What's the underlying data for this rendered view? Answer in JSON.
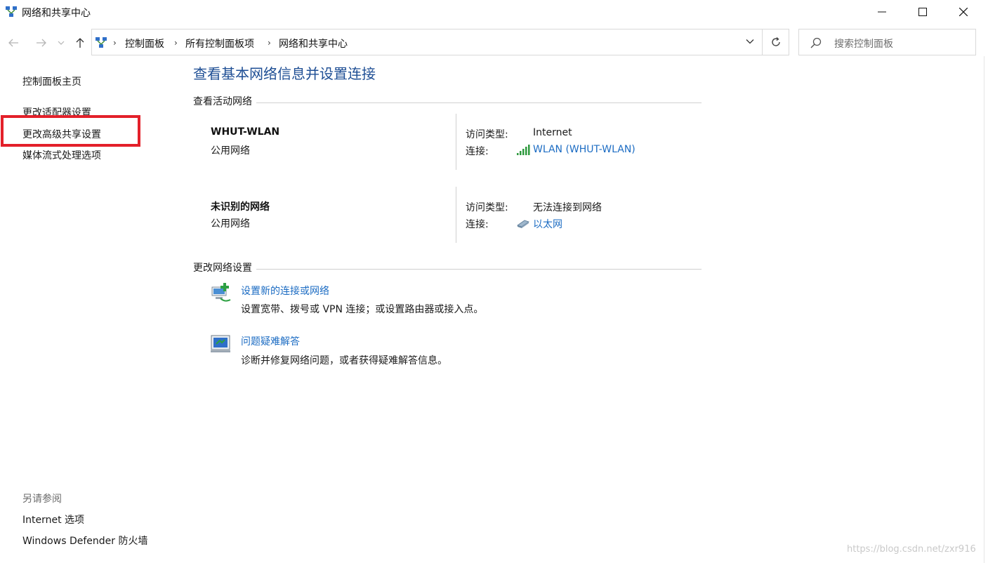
{
  "window": {
    "title": "网络和共享中心"
  },
  "nav": {
    "breadcrumbs": [
      "控制面板",
      "所有控制面板项",
      "网络和共享中心"
    ],
    "search_placeholder": "搜索控制面板"
  },
  "left_pane": {
    "links": [
      "控制面板主页",
      "更改适配器设置",
      "更改高级共享设置",
      "媒体流式处理选项"
    ],
    "see_also_title": "另请参阅",
    "see_also_links": [
      "Internet 选项",
      "Windows Defender 防火墙"
    ]
  },
  "main": {
    "title": "查看基本网络信息并设置连接",
    "active_networks_heading": "查看活动网络",
    "networks": [
      {
        "name": "WHUT-WLAN",
        "category": "公用网络",
        "access_type_label": "访问类型:",
        "access_type": "Internet",
        "connection_label": "连接:",
        "connection": "WLAN (WHUT-WLAN)",
        "connection_icon": "wifi-signal-icon"
      },
      {
        "name": "未识别的网络",
        "category": "公用网络",
        "access_type_label": "访问类型:",
        "access_type": "无法连接到网络",
        "connection_label": "连接:",
        "connection": "以太网",
        "connection_icon": "ethernet-icon"
      }
    ],
    "change_settings_heading": "更改网络设置",
    "tasks": [
      {
        "link": "设置新的连接或网络",
        "description": "设置宽带、拨号或 VPN 连接；或设置路由器或接入点。",
        "icon": "new-connection-icon"
      },
      {
        "link": "问题疑难解答",
        "description": "诊断并修复网络问题，或者获得疑难解答信息。",
        "icon": "troubleshoot-icon"
      }
    ]
  },
  "watermark": "https://blog.csdn.net/zxr916",
  "colors": {
    "title_blue": "#1e4e94",
    "link_blue": "#1c6cc3",
    "highlight_red": "#e3202a"
  }
}
